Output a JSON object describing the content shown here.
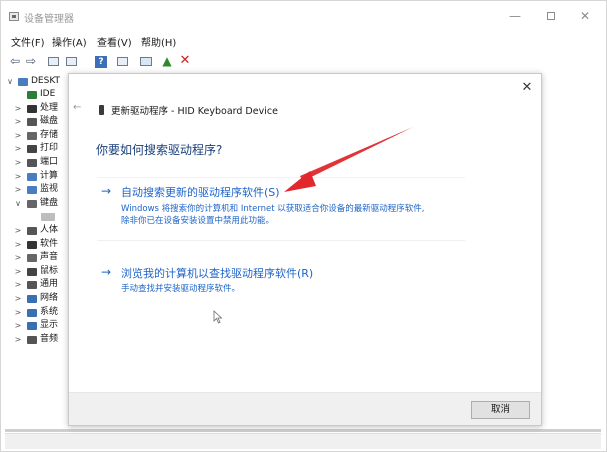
{
  "window": {
    "title": "设备管理器",
    "controls": {
      "minimize": "—",
      "maximize": "",
      "close": "✕"
    }
  },
  "menu": {
    "file": "文件(F)",
    "action": "操作(A)",
    "view": "查看(V)",
    "help": "帮助(H)"
  },
  "toolbar": {
    "back": "⇦",
    "forward": "⇨",
    "help": "?",
    "update": "▲",
    "remove": "✕"
  },
  "tree": {
    "root": {
      "chev": "∨",
      "label": "DESKT"
    },
    "items": [
      {
        "chev": "",
        "label": "IDE"
      },
      {
        "chev": ">",
        "label": "处理"
      },
      {
        "chev": ">",
        "label": "磁盘"
      },
      {
        "chev": ">",
        "label": "存储"
      },
      {
        "chev": ">",
        "label": "打印"
      },
      {
        "chev": ">",
        "label": "端口"
      },
      {
        "chev": ">",
        "label": "计算"
      },
      {
        "chev": ">",
        "label": "监视"
      },
      {
        "chev": "∨",
        "label": "键盘"
      },
      {
        "chev": "",
        "label": ""
      },
      {
        "chev": ">",
        "label": "人体"
      },
      {
        "chev": ">",
        "label": "软件"
      },
      {
        "chev": ">",
        "label": "声音"
      },
      {
        "chev": ">",
        "label": "鼠标"
      },
      {
        "chev": ">",
        "label": "通用"
      },
      {
        "chev": ">",
        "label": "网络"
      },
      {
        "chev": ">",
        "label": "系统"
      },
      {
        "chev": ">",
        "label": "显示"
      },
      {
        "chev": ">",
        "label": "音频"
      }
    ]
  },
  "dialog": {
    "close": "✕",
    "back": "←",
    "title": "更新驱动程序 - HID Keyboard Device",
    "question": "你要如何搜索驱动程序?",
    "options": [
      {
        "arrow": "→",
        "title": "自动搜索更新的驱动程序软件(S)",
        "desc_line1": "Windows 将搜索你的计算机和 Internet 以获取适合你设备的最新驱动程序软件,",
        "desc_line2": "除非你已在设备安装设置中禁用此功能。"
      },
      {
        "arrow": "→",
        "title": "浏览我的计算机以查找驱动程序软件(R)",
        "desc_line1": "手动查找并安装驱动程序软件。"
      }
    ],
    "cancel": "取消"
  },
  "colors": {
    "link_blue": "#1e64c8",
    "question_blue": "#1a3f7a",
    "annotation_red": "#e0282d"
  }
}
